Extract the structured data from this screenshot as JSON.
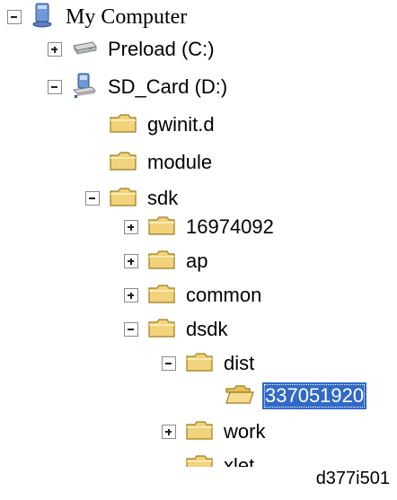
{
  "tree": {
    "root": {
      "label": "My Computer",
      "state": "expanded",
      "icon": "my-computer-icon"
    },
    "preload": {
      "label": "Preload (C:)",
      "state": "collapsed",
      "icon": "drive-icon"
    },
    "sd_card": {
      "label": "SD_Card (D:)",
      "state": "expanded",
      "icon": "network-drive-icon"
    },
    "gwinit": {
      "label": "gwinit.d",
      "icon": "folder-icon"
    },
    "module": {
      "label": "module",
      "icon": "folder-icon"
    },
    "sdk": {
      "label": "sdk",
      "state": "expanded",
      "icon": "folder-icon"
    },
    "f16974092": {
      "label": "16974092",
      "state": "collapsed",
      "icon": "folder-icon"
    },
    "ap": {
      "label": "ap",
      "state": "collapsed",
      "icon": "folder-icon"
    },
    "common": {
      "label": "common",
      "state": "collapsed",
      "icon": "folder-icon"
    },
    "dsdk": {
      "label": "dsdk",
      "state": "expanded",
      "icon": "folder-icon"
    },
    "dist": {
      "label": "dist",
      "state": "expanded",
      "icon": "folder-icon"
    },
    "f337051920": {
      "label": "337051920",
      "selected": true,
      "icon": "folder-open-icon"
    },
    "work": {
      "label": "work",
      "state": "collapsed",
      "icon": "folder-icon"
    },
    "xlet": {
      "label": "xlet",
      "icon": "folder-icon"
    }
  },
  "caption": "d377i501",
  "colors": {
    "selection": "#3169c6",
    "folder": "#f2d27a",
    "folder_border": "#a07b1f"
  }
}
